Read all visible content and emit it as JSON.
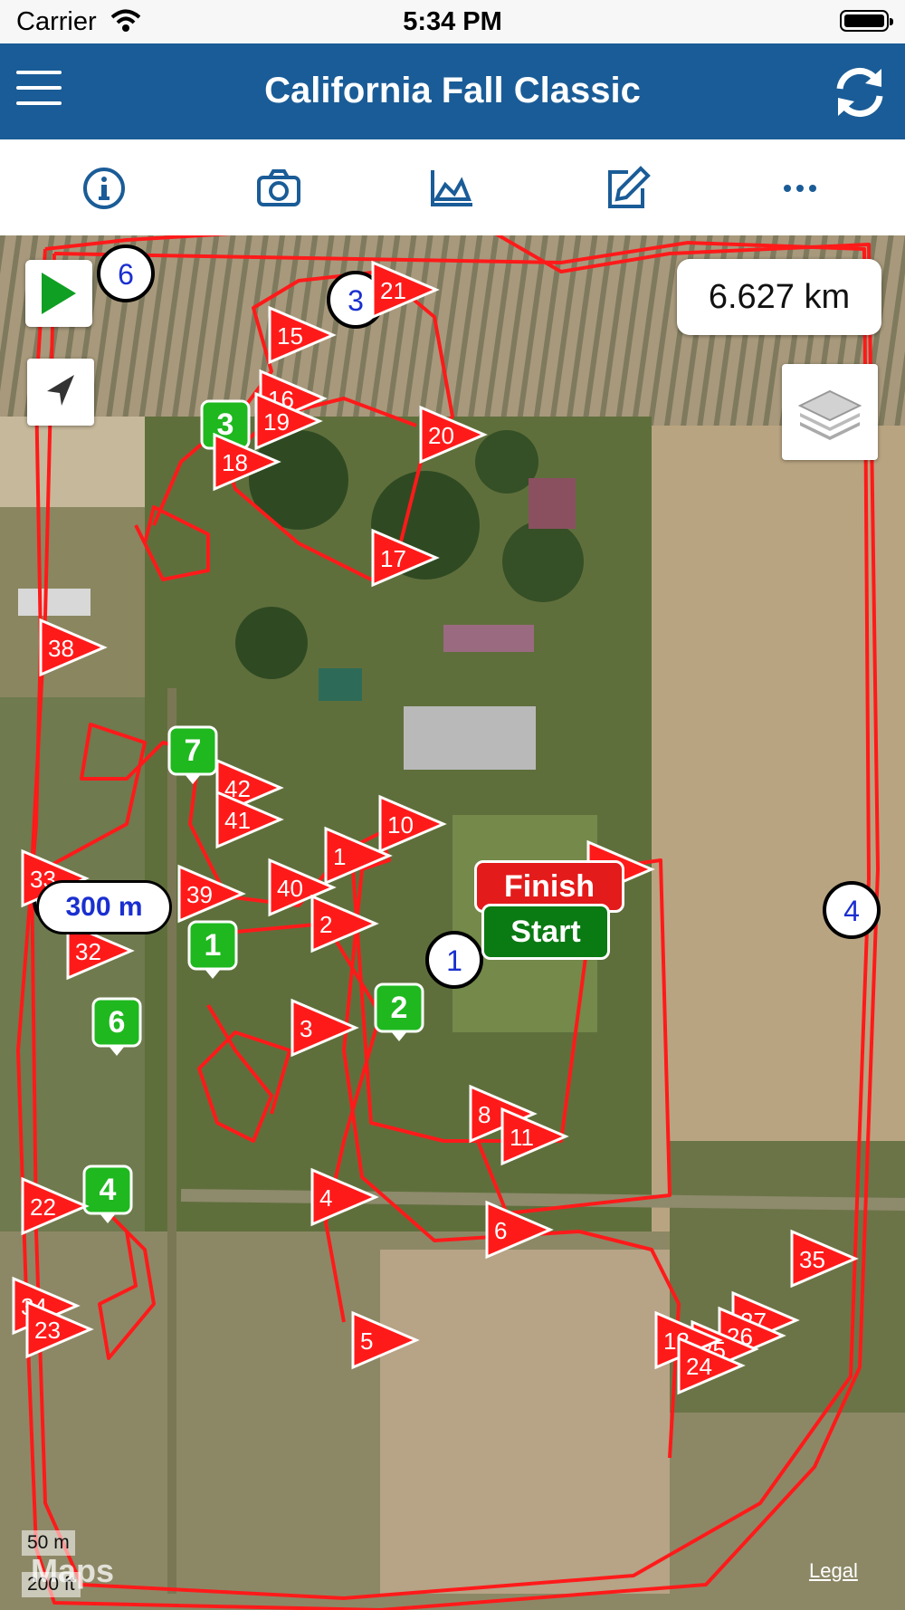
{
  "status_bar": {
    "carrier": "Carrier",
    "time": "5:34 PM"
  },
  "nav": {
    "title": "California Fall Classic",
    "menu_icon": "hamburger-menu-icon",
    "refresh_icon": "refresh-icon"
  },
  "toolbar": {
    "icons": [
      "info-icon",
      "camera-icon",
      "chart-icon",
      "edit-icon",
      "more-icon"
    ]
  },
  "map": {
    "distance": "6.627 km",
    "segment_distance": "300 m",
    "finish_label": "Finish",
    "start_label": "Start",
    "scale_top": "50 m",
    "scale_bottom": "200 ft",
    "maps_logo": "Maps",
    "legal": "Legal",
    "colors": {
      "track": "#ff1a1a",
      "flag": "#ff1a1a",
      "green_marker": "#1fb81f",
      "nav_blue": "#1a5c97",
      "start": "#0a7a13",
      "finish": "#e41b1b"
    },
    "green_markers": [
      "3",
      "7",
      "1",
      "2",
      "6",
      "4"
    ],
    "circle_markers": [
      "6",
      "3",
      "1",
      "4"
    ],
    "flags": [
      "21",
      "15",
      "16",
      "19",
      "20",
      "18",
      "17",
      "38",
      "42",
      "41",
      "10",
      "1",
      "33",
      "39",
      "40",
      "2",
      "32",
      "3",
      "7",
      "8",
      "11",
      "4",
      "6",
      "22",
      "5",
      "35",
      "27",
      "26",
      "25",
      "13",
      "24",
      "34",
      "23"
    ]
  }
}
